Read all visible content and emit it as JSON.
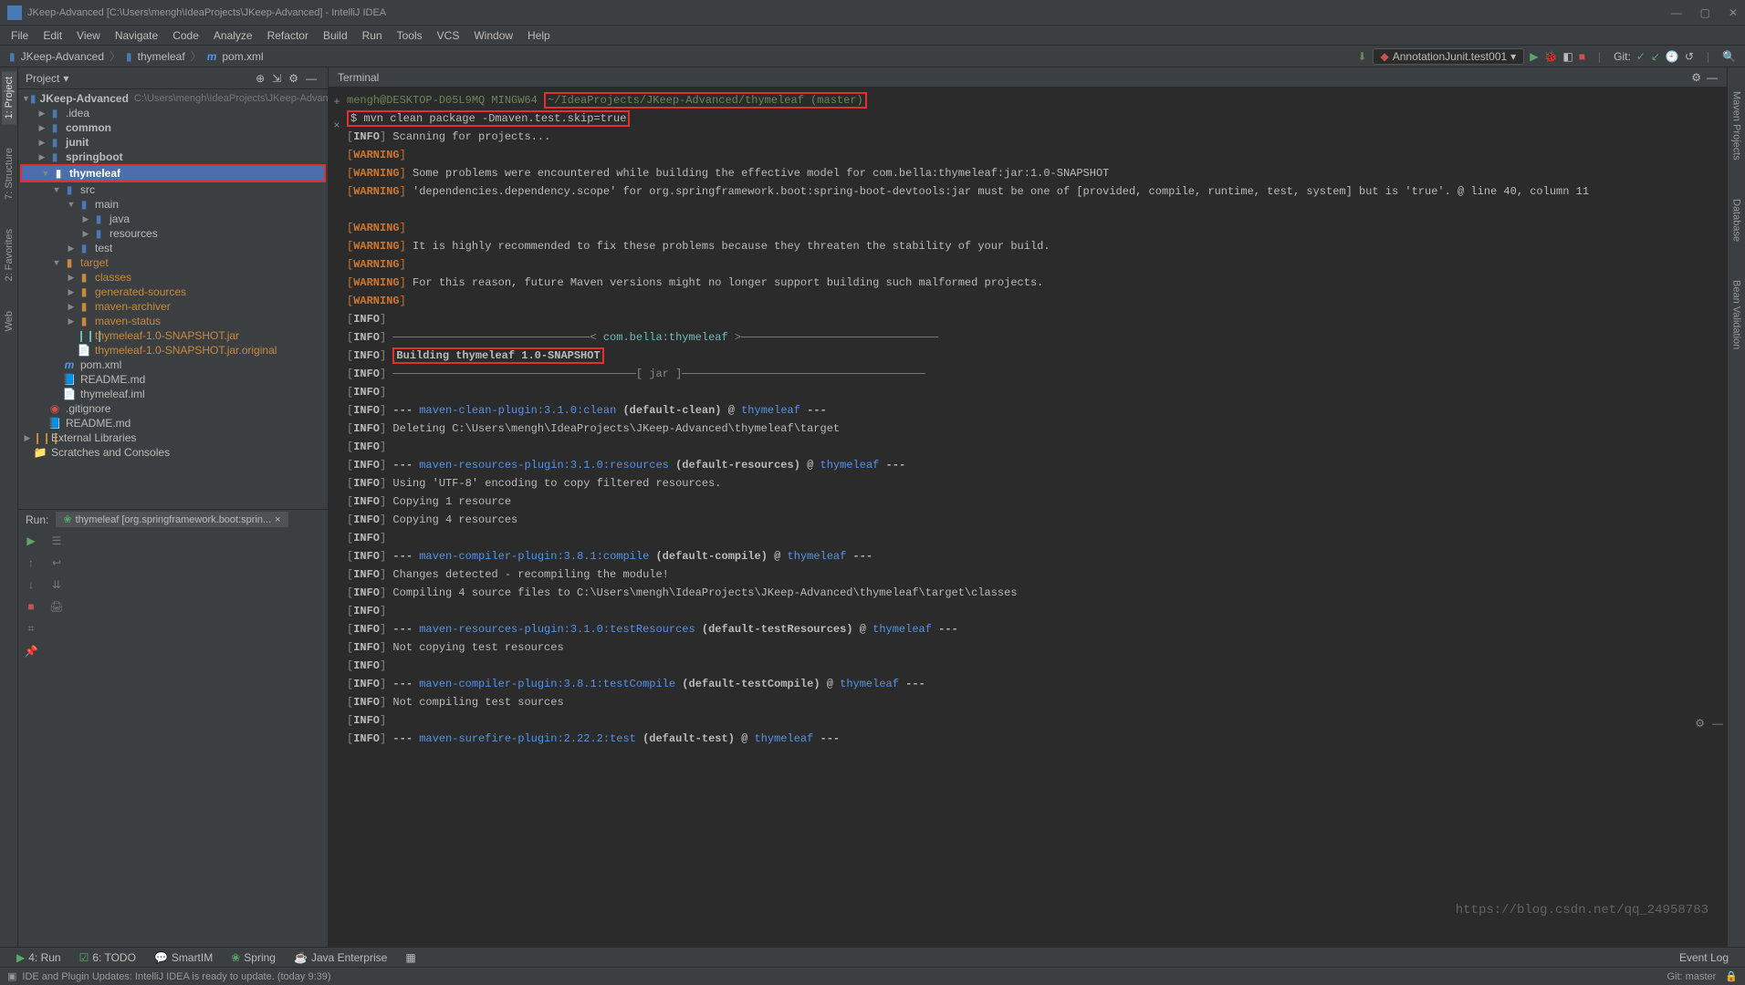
{
  "window": {
    "title": "JKeep-Advanced [C:\\Users\\mengh\\IdeaProjects\\JKeep-Advanced] - IntelliJ IDEA"
  },
  "menu": [
    "File",
    "Edit",
    "View",
    "Navigate",
    "Code",
    "Analyze",
    "Refactor",
    "Build",
    "Run",
    "Tools",
    "VCS",
    "Window",
    "Help"
  ],
  "breadcrumb": {
    "root": "JKeep-Advanced",
    "mid": "thymeleaf",
    "file": "pom.xml",
    "file_icon_letter": "m"
  },
  "run_config": "AnnotationJunit.test001",
  "git_label": "Git:",
  "left_tabs": [
    "1: Project",
    "7: Structure",
    "2: Favorites",
    "Web"
  ],
  "right_tabs": [
    "Maven Projects",
    "Database",
    "Bean Validation"
  ],
  "project": {
    "header": "Project",
    "root": "JKeep-Advanced",
    "root_path": "C:\\Users\\mengh\\IdeaProjects\\JKeep-Advanced",
    "nodes": {
      "idea": ".idea",
      "common": "common",
      "junit": "junit",
      "springboot": "springboot",
      "thymeleaf": "thymeleaf",
      "src": "src",
      "main": "main",
      "java": "java",
      "resources": "resources",
      "test": "test",
      "target": "target",
      "classes": "classes",
      "gensrc": "generated-sources",
      "mvnarch": "maven-archiver",
      "mvnstat": "maven-status",
      "jar1": "thymeleaf-1.0-SNAPSHOT.jar",
      "jar2": "thymeleaf-1.0-SNAPSHOT.jar.original",
      "pom": "pom.xml",
      "readme": "README.md",
      "iml": "thymeleaf.iml",
      "gitignore": ".gitignore",
      "readme2": "README.md",
      "extlib": "External Libraries",
      "scratch": "Scratches and Consoles"
    }
  },
  "terminal": {
    "title": "Terminal",
    "prompt_user": "mengh@DESKTOP-D05L9MQ MINGW64",
    "prompt_path": "~/IdeaProjects/JKeep-Advanced/thymeleaf",
    "prompt_branch": "(master)",
    "command": "$ mvn clean package -Dmaven.test.skip=true",
    "lines": [
      {
        "tag": "INFO",
        "text": "Scanning for projects..."
      },
      {
        "tag": "WARNING",
        "text": ""
      },
      {
        "tag": "WARNING",
        "text": "Some problems were encountered while building the effective model for com.bella:thymeleaf:jar:1.0-SNAPSHOT"
      },
      {
        "tag": "WARNING",
        "text": "'dependencies.dependency.scope' for org.springframework.boot:spring-boot-devtools:jar must be one of [provided, compile, runtime, test, system] but is 'true'. @ line 40, column 11"
      },
      {
        "blank": true
      },
      {
        "tag": "WARNING",
        "text": ""
      },
      {
        "tag": "WARNING",
        "text": "It is highly recommended to fix these problems because they threaten the stability of your build."
      },
      {
        "tag": "WARNING",
        "text": ""
      },
      {
        "tag": "WARNING",
        "text": "For this reason, future Maven versions might no longer support building such malformed projects."
      },
      {
        "tag": "WARNING",
        "text": ""
      },
      {
        "tag": "INFO",
        "text": ""
      },
      {
        "tag": "INFO",
        "raw": "header1"
      },
      {
        "tag": "INFO",
        "raw": "building",
        "box": true
      },
      {
        "tag": "INFO",
        "raw": "header2"
      },
      {
        "tag": "INFO",
        "text": ""
      },
      {
        "tag": "INFO",
        "raw": "plugin_clean"
      },
      {
        "tag": "INFO",
        "text": "Deleting C:\\Users\\mengh\\IdeaProjects\\JKeep-Advanced\\thymeleaf\\target"
      },
      {
        "tag": "INFO",
        "text": ""
      },
      {
        "tag": "INFO",
        "raw": "plugin_res1"
      },
      {
        "tag": "INFO",
        "text": "Using 'UTF-8' encoding to copy filtered resources."
      },
      {
        "tag": "INFO",
        "text": "Copying 1 resource"
      },
      {
        "tag": "INFO",
        "text": "Copying 4 resources"
      },
      {
        "tag": "INFO",
        "text": ""
      },
      {
        "tag": "INFO",
        "raw": "plugin_compile"
      },
      {
        "tag": "INFO",
        "text": "Changes detected - recompiling the module!"
      },
      {
        "tag": "INFO",
        "text": "Compiling 4 source files to C:\\Users\\mengh\\IdeaProjects\\JKeep-Advanced\\thymeleaf\\target\\classes"
      },
      {
        "tag": "INFO",
        "text": ""
      },
      {
        "tag": "INFO",
        "raw": "plugin_testres"
      },
      {
        "tag": "INFO",
        "text": "Not copying test resources"
      },
      {
        "tag": "INFO",
        "text": ""
      },
      {
        "tag": "INFO",
        "raw": "plugin_testcompile"
      },
      {
        "tag": "INFO",
        "text": "Not compiling test sources"
      },
      {
        "tag": "INFO",
        "text": ""
      },
      {
        "tag": "INFO",
        "raw": "plugin_surefire"
      }
    ],
    "raws": {
      "header1": {
        "pre": "──────────────────────────────< ",
        "mid": "com.bella:thymeleaf",
        "post": " >──────────────────────────────"
      },
      "building": {
        "text": "Building thymeleaf 1.0-SNAPSHOT"
      },
      "header2": {
        "pre": "─────────────────────────────────────[ jar ]─────────────────────────────────────"
      },
      "plugin_clean": {
        "dash": "--- ",
        "link": "maven-clean-plugin:3.1.0:clean",
        "mid": " (default-clean) @ ",
        "proj": "thymeleaf",
        "end": " ---"
      },
      "plugin_res1": {
        "dash": "--- ",
        "link": "maven-resources-plugin:3.1.0:resources",
        "mid": " (default-resources) @ ",
        "proj": "thymeleaf",
        "end": " ---"
      },
      "plugin_compile": {
        "dash": "--- ",
        "link": "maven-compiler-plugin:3.8.1:compile",
        "mid": " (default-compile) @ ",
        "proj": "thymeleaf",
        "end": " ---"
      },
      "plugin_testres": {
        "dash": "--- ",
        "link": "maven-resources-plugin:3.1.0:testResources",
        "mid": " (default-testResources) @ ",
        "proj": "thymeleaf",
        "end": " ---"
      },
      "plugin_testcompile": {
        "dash": "--- ",
        "link": "maven-compiler-plugin:3.8.1:testCompile",
        "mid": " (default-testCompile) @ ",
        "proj": "thymeleaf",
        "end": " ---"
      },
      "plugin_surefire": {
        "dash": "--- ",
        "link": "maven-surefire-plugin:2.22.2:test",
        "mid": " (default-test) @ ",
        "proj": "thymeleaf",
        "end": " ---"
      }
    }
  },
  "run": {
    "label": "Run:",
    "tab": "thymeleaf [org.springframework.boot:sprin..."
  },
  "bottom_tabs": [
    "4: Run",
    "6: TODO",
    "SmartIM",
    "Spring",
    "Java Enterprise"
  ],
  "status": {
    "msg": "IDE and Plugin Updates: IntelliJ IDEA is ready to update. (today 9:39)",
    "git": "Git: master",
    "event_log": "Event Log"
  },
  "watermark": "https://blog.csdn.net/qq_24958783"
}
